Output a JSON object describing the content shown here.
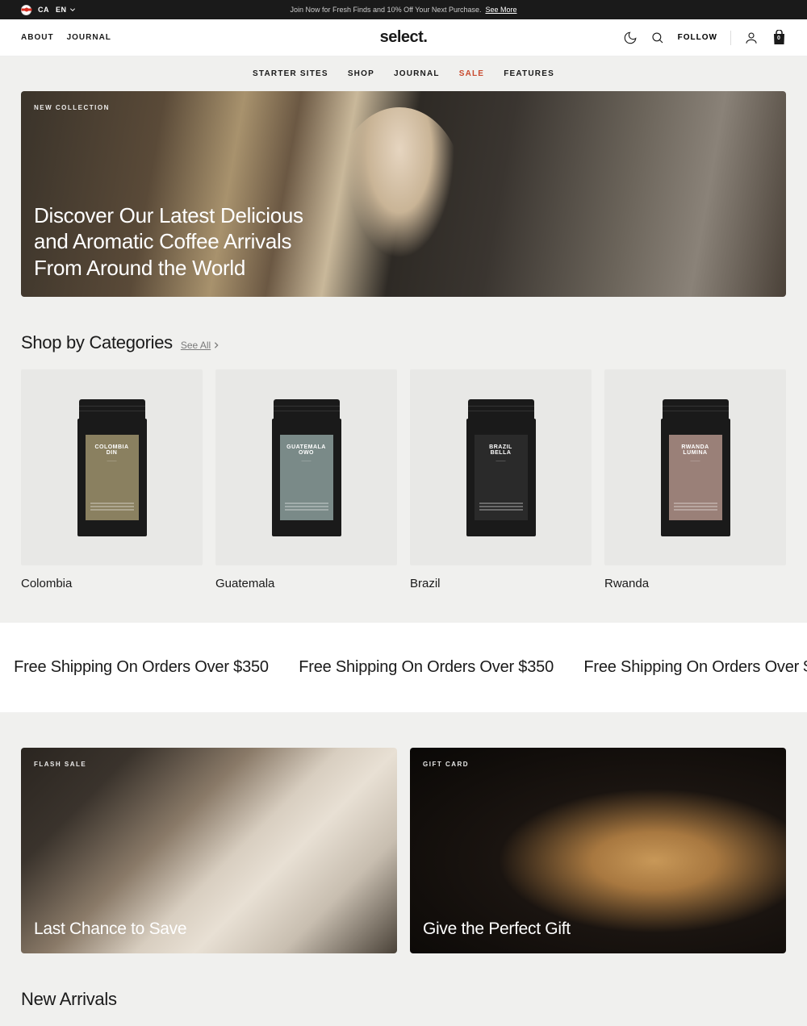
{
  "announcement": {
    "country": "CA",
    "language": "EN",
    "message": "Join Now for Fresh Finds and 10% Off Your Next Purchase.",
    "see_more": "See More"
  },
  "header": {
    "about": "ABOUT",
    "journal": "JOURNAL",
    "logo": "select.",
    "follow": "FOLLOW",
    "cart_count": "0"
  },
  "main_nav": {
    "items": [
      {
        "label": "STARTER SITES",
        "sale": false
      },
      {
        "label": "SHOP",
        "sale": false
      },
      {
        "label": "JOURNAL",
        "sale": false
      },
      {
        "label": "SALE",
        "sale": true
      },
      {
        "label": "FEATURES",
        "sale": false
      }
    ]
  },
  "hero": {
    "label": "NEW COLLECTION",
    "title": "Discover Our Latest Delicious and Aromatic Coffee Arrivals From Around the World"
  },
  "categories": {
    "title": "Shop by Categories",
    "see_all": "See All",
    "items": [
      {
        "name": "Colombia",
        "bag_title": "COLOMBIA DIN",
        "label_color": "#8a8060"
      },
      {
        "name": "Guatemala",
        "bag_title": "GUATEMALA OWO",
        "label_color": "#7a8a88"
      },
      {
        "name": "Brazil",
        "bag_title": "BRAZIL BELLA",
        "label_color": "#2a2a2a"
      },
      {
        "name": "Rwanda",
        "bag_title": "RWANDA LUMINA",
        "label_color": "#9a8078"
      }
    ]
  },
  "marquee": {
    "text": "Free Shipping On Orders Over $350"
  },
  "promos": [
    {
      "label": "FLASH SALE",
      "title": "Last Chance to Save"
    },
    {
      "label": "GIFT CARD",
      "title": "Give the Perfect Gift"
    }
  ],
  "new_arrivals": {
    "title": "New Arrivals"
  }
}
